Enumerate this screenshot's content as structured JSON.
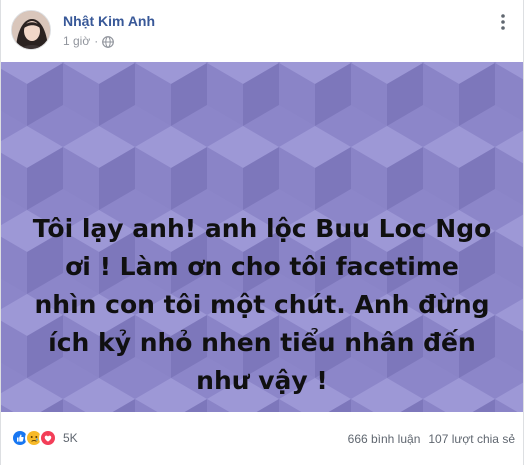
{
  "post": {
    "author_name": "Nhật Kim Anh",
    "timestamp": "1 giờ",
    "separator": "·",
    "audience_icon": "globe-icon",
    "options_icon": "more-options-icon",
    "text": "Tôi lạy anh! anh lộc Buu Loc Ngo ơi ! Làm ơn cho tôi facetime nhìn con tôi một chút. Anh đừng ích kỷ nhỏ nhen tiểu nhân đến như vậy !",
    "background_color": "#8c86c9"
  },
  "engagement": {
    "reaction_icons": [
      "like-icon",
      "sad-icon",
      "love-icon"
    ],
    "reaction_count": "5K",
    "comments": "666 bình luận",
    "shares": "107 lượt chia sẻ"
  },
  "colors": {
    "author_link": "#385898",
    "meta_gray": "#90949c",
    "like_blue": "#1877f2",
    "sad_yellow": "#f7b928",
    "love_red": "#f33e58"
  }
}
